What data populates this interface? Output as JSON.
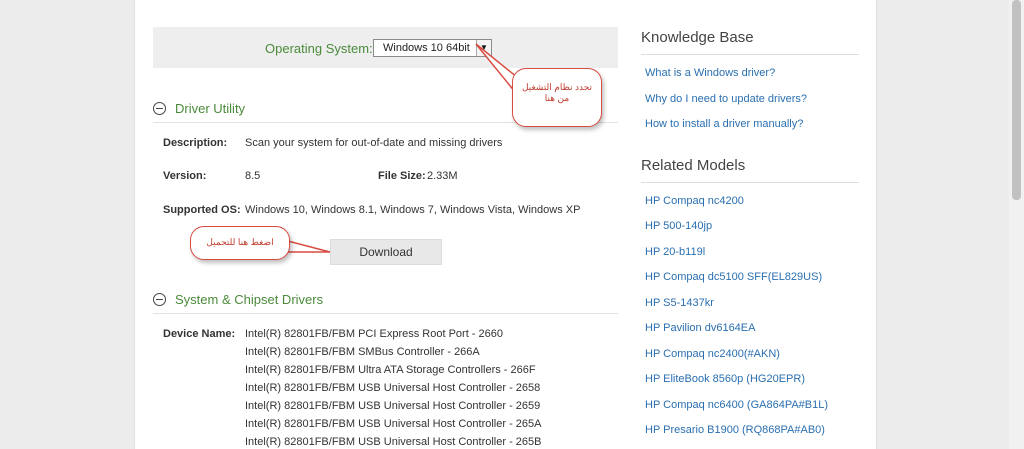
{
  "os_selector": {
    "label": "Operating System:",
    "selected": "Windows 10 64bit"
  },
  "driver_utility": {
    "title": "Driver Utility",
    "description_label": "Description:",
    "description": "Scan your system for out-of-date and missing drivers",
    "version_label": "Version:",
    "version": "8.5",
    "filesize_label": "File Size:",
    "filesize": "2.33M",
    "os_label": "Supported OS:",
    "os": "Windows 10, Windows 8.1, Windows 7, Windows Vista, Windows XP",
    "download_label": "Download"
  },
  "chipset": {
    "title": "System & Chipset Drivers",
    "device_label": "Device Name:",
    "devices": [
      "Intel(R) 82801FB/FBM PCI Express Root Port - 2660",
      "Intel(R) 82801FB/FBM SMBus Controller - 266A",
      "Intel(R) 82801FB/FBM Ultra ATA Storage Controllers - 266F",
      "Intel(R) 82801FB/FBM USB Universal Host Controller - 2658",
      "Intel(R) 82801FB/FBM USB Universal Host Controller - 2659",
      "Intel(R) 82801FB/FBM USB Universal Host Controller - 265A",
      "Intel(R) 82801FB/FBM USB Universal Host Controller - 265B"
    ]
  },
  "knowledge_base": {
    "title": "Knowledge Base",
    "links": [
      "What is a Windows driver?",
      "Why do I need to update drivers?",
      "How to install a driver manually?"
    ]
  },
  "related_models": {
    "title": "Related Models",
    "links": [
      "HP Compaq nc4200",
      "HP 500-140jp",
      "HP 20-b119l",
      "HP Compaq dc5100 SFF(EL829US)",
      "HP S5-1437kr",
      "HP Pavilion dv6164EA",
      "HP Compaq nc2400(#AKN)",
      "HP EliteBook 8560p (HG20EPR)",
      "HP Compaq nc6400 (GA864PA#B1L)",
      "HP Presario B1900 (RQ868PA#AB0)"
    ]
  },
  "annotations": {
    "os_callout_line1": "تحدد نظام التشغيل",
    "os_callout_line2": "من هنا",
    "download_callout": "اضغط هنا للتحميل",
    "callout_color": "#d94b40"
  },
  "colors": {
    "section_green": "#4a8a3a",
    "link_blue": "#2a6fb0"
  }
}
